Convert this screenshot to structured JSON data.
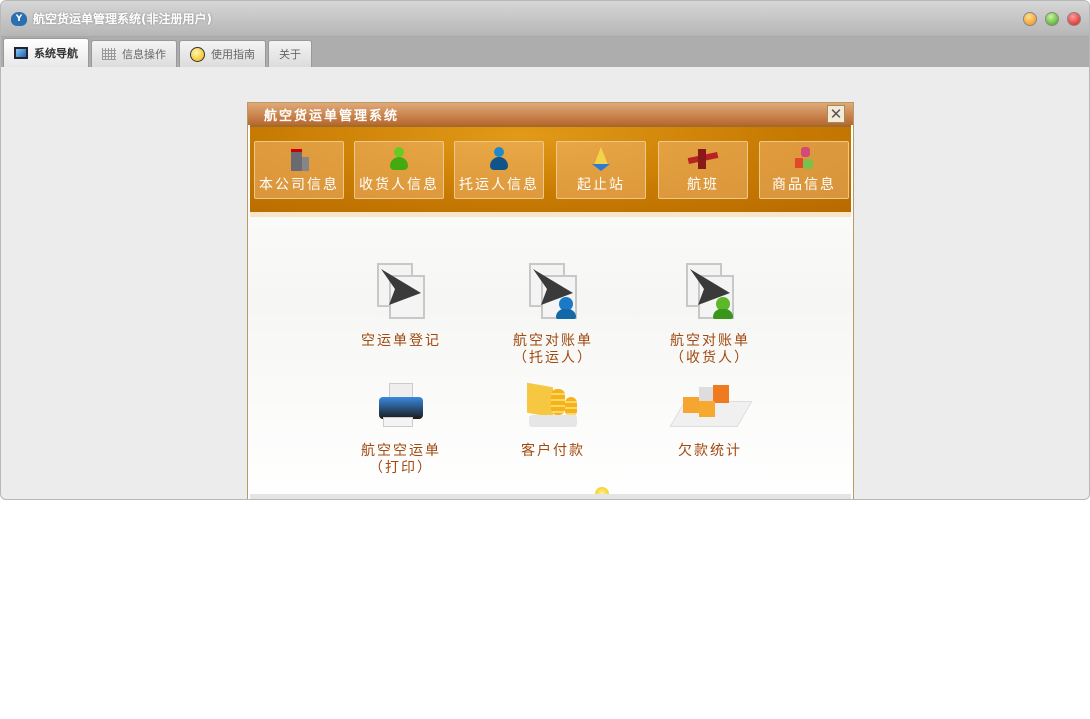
{
  "window": {
    "title": "航空货运单管理系统(非注册用户)",
    "logo_text": "Y"
  },
  "tabs": [
    {
      "label": "系统导航",
      "active": true
    },
    {
      "label": "信息操作"
    },
    {
      "label": "使用指南"
    },
    {
      "label": "关于"
    }
  ],
  "panel": {
    "title": "航空货运单管理系统",
    "close": "✕"
  },
  "toolbar": [
    "本公司信息",
    "收货人信息",
    "托运人信息",
    "起止站",
    "航班",
    "商品信息"
  ],
  "functions": [
    {
      "line1": "空运单登记",
      "line2": ""
    },
    {
      "line1": "航空对账单",
      "line2": "（托运人）"
    },
    {
      "line1": "航空对账单",
      "line2": "（收货人）"
    },
    {
      "line1": "航空空运单",
      "line2": "（打印）"
    },
    {
      "line1": "客户付款",
      "line2": ""
    },
    {
      "line1": "欠款统计",
      "line2": ""
    }
  ]
}
